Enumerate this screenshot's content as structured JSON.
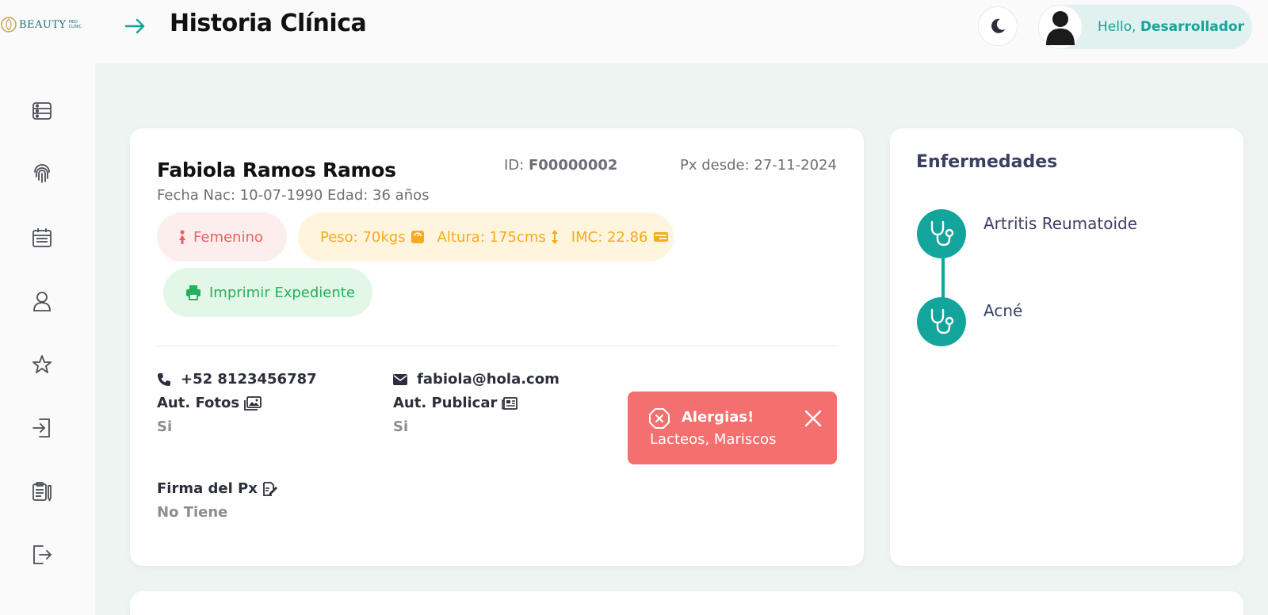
{
  "app": {
    "logo_text": "BEAUTY",
    "logo_sub": "MED CLINIC",
    "page_title": "Historia Clínica"
  },
  "user": {
    "greeting": "Hello,",
    "name": "Desarrollador"
  },
  "sidebar": {
    "icons": [
      "dashboard-icon",
      "fingerprint-icon",
      "calendar-icon",
      "user-icon",
      "star-icon",
      "login-icon",
      "clipboard-icon",
      "logout-icon"
    ]
  },
  "patient": {
    "name": "Fabiola Ramos Ramos",
    "id_label": "ID:",
    "id_value": "F00000002",
    "since": "Px desde: 27-11-2024",
    "birth": "Fecha Nac: 10-07-1990 Edad: 36 años",
    "gender": "Femenino",
    "weight": "Peso: 70kgs",
    "height": "Altura: 175cms",
    "imc": "IMC: 22.86",
    "print_label": "Imprimir Expediente",
    "phone": "+52 8123456787",
    "email": "fabiola@hola.com",
    "aut_fotos_label": "Aut. Fotos",
    "aut_fotos_value": "Si",
    "aut_publicar_label": "Aut. Publicar",
    "aut_publicar_value": "Si",
    "firma_label": "Firma del Px",
    "firma_value": "No Tiene"
  },
  "alert": {
    "title": "Alergias!",
    "text": "Lacteos, Mariscos"
  },
  "diseases": {
    "title": "Enfermedades",
    "items": [
      "Artritis Reumatoide",
      "Acné"
    ]
  },
  "colors": {
    "accent": "#13a49b",
    "alert": "#f4706e",
    "gender": "#ef5f5f",
    "measures": "#f5ab1d",
    "print": "#21b35b"
  }
}
